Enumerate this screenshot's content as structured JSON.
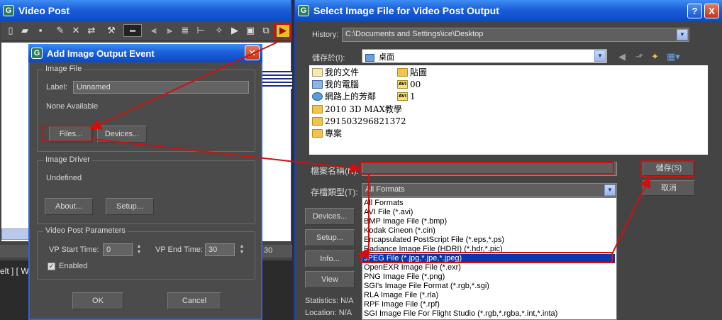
{
  "video_post": {
    "title": "Video Post",
    "bottom_value": "30",
    "status_text": "elt ] [ Wi"
  },
  "add_event": {
    "title": "Add Image Output Event",
    "image_file_group": "Image File",
    "label_caption": "Label:",
    "label_value": "Unnamed",
    "none_available": "None Available",
    "files_button": "Files...",
    "devices_button": "Devices...",
    "image_driver_group": "Image Driver",
    "undefined": "Undefined",
    "about_button": "About...",
    "setup_button": "Setup...",
    "vp_params_group": "Video Post Parameters",
    "vp_start_label": "VP Start Time:",
    "vp_start_value": "0",
    "vp_end_label": "VP End Time:",
    "vp_end_value": "30",
    "enabled_label": "Enabled",
    "ok_button": "OK",
    "cancel_button": "Cancel"
  },
  "file_dialog": {
    "title": "Select Image File for Video Post Output",
    "help_label": "?",
    "close_label": "X",
    "history_label": "History:",
    "history_value": "C:\\Documents and Settings\\ice\\Desktop",
    "save_in_label": "儲存於(I):",
    "save_in_value": "桌面",
    "files": [
      {
        "name": "我的文件",
        "icon": "documents-icon"
      },
      {
        "name": "我的電腦",
        "icon": "computer-icon"
      },
      {
        "name": "網路上的芳鄰",
        "icon": "network-icon"
      },
      {
        "name": "2010 3D MAX教學",
        "icon": "folder-icon"
      },
      {
        "name": "291503296821372",
        "icon": "folder-icon"
      },
      {
        "name": "專案",
        "icon": "folder-icon"
      },
      {
        "name": "貼圖",
        "icon": "folder-icon"
      },
      {
        "name": "00",
        "icon": "avi-icon"
      },
      {
        "name": "1",
        "icon": "avi-icon"
      }
    ],
    "filename_label": "檔案名稱(N):",
    "filename_value": "",
    "filetype_label": "存檔類型(T):",
    "filetype_value": "All Formats",
    "save_button": "儲存(S)",
    "cancel_button": "取消",
    "devices_button": "Devices...",
    "setup_button": "Setup...",
    "info_button": "Info...",
    "view_button": "View",
    "statistics_label": "Statistics: N/A",
    "location_label": "Location: N/A",
    "file_types": [
      "All Formats",
      "AVI File (*.avi)",
      "BMP Image File (*.bmp)",
      "Kodak Cineon (*.cin)",
      "Encapsulated PostScript File (*.eps,*.ps)",
      "Radiance Image File (HDRI) (*.hdr,*.pic)",
      "JPEG File (*.jpg,*.jpe,*.jpeg)",
      "OpenEXR Image File (*.exr)",
      "PNG Image File (*.png)",
      "SGI's Image File Format (*.rgb,*.sgi)",
      "RLA Image File (*.rla)",
      "RPF Image File (*.rpf)",
      "SGI Image File For Flight Studio (*.rgb,*.rgba,*.int,*.inta)"
    ],
    "selected_type_index": 6,
    "colors": {
      "selection": "#0a36a8",
      "annotation": "#d01010"
    }
  }
}
